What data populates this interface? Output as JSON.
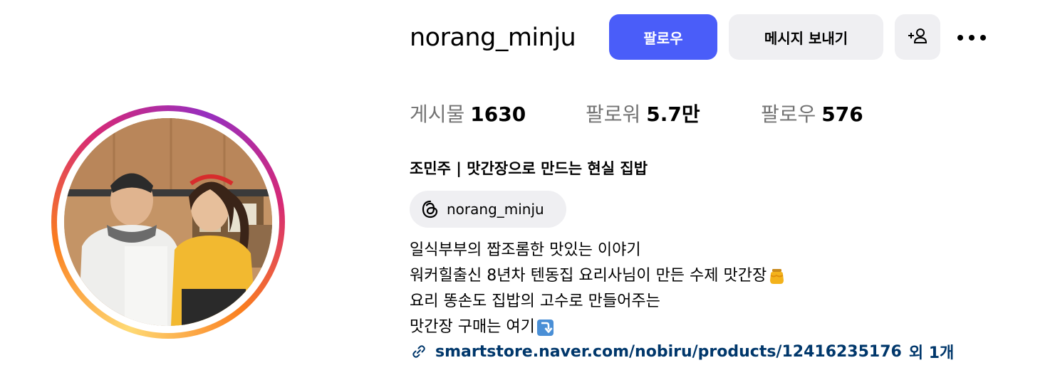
{
  "profile": {
    "username": "norang_minju",
    "full_name": "조민주 | 맛간장으로 만드는 현실 집밥"
  },
  "actions": {
    "follow_label": "팔로우",
    "message_label": "메시지 보내기",
    "add_user_icon": "add-person-icon",
    "more_icon": "more-horizontal-icon"
  },
  "stats": {
    "posts_label": "게시물",
    "posts_value": "1630",
    "followers_label": "팔로워",
    "followers_value": "5.7만",
    "following_label": "팔로우",
    "following_value": "576"
  },
  "threads": {
    "icon": "threads-icon",
    "handle": "norang_minju"
  },
  "bio": {
    "line1": "일식부부의 짭조롬한 맛있는 이야기",
    "line2": "워커힐출신 8년차 텐동집 요리사님이 만든 수제 맛간장",
    "line2_emoji": "honey-pot-emoji",
    "line3": "요리 똥손도 집밥의 고수로 만들어주는",
    "line4": "맛간장 구매는 여기",
    "line4_emoji": "down-arrow-emoji"
  },
  "link": {
    "icon": "link-icon",
    "url": "smartstore.naver.com/nobiru/products/12416235176",
    "extra": "외 1개"
  },
  "colors": {
    "follow_button": "#4a5df9",
    "secondary_button": "#efeff2",
    "link_text": "#00376b",
    "muted_text": "#737373"
  }
}
